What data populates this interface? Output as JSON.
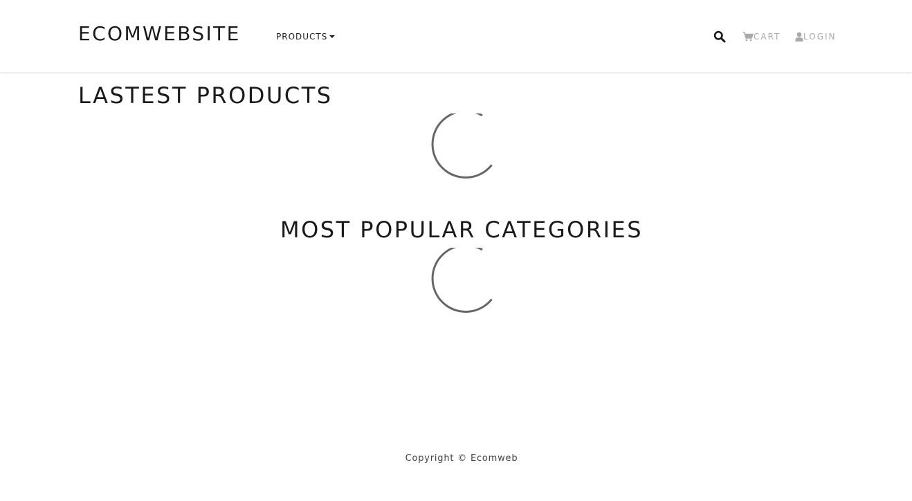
{
  "header": {
    "brand": "ECOMWEBSITE",
    "products_menu": "PRODUCTS",
    "search_icon": "search-icon",
    "cart_label": "CART",
    "cart_icon": "cart-icon",
    "login_label": "LOGIN",
    "login_icon": "user-icon"
  },
  "sections": {
    "latest_products_title": "LASTEST PRODUCTS",
    "popular_categories_title": "MOST POPULAR CATEGORIES"
  },
  "footer": {
    "copyright": "Copyright © Ecomweb"
  },
  "colors": {
    "text": "#1a1a1a",
    "muted": "#a9a9a9",
    "spinner": "#666666",
    "background": "#ffffff"
  }
}
